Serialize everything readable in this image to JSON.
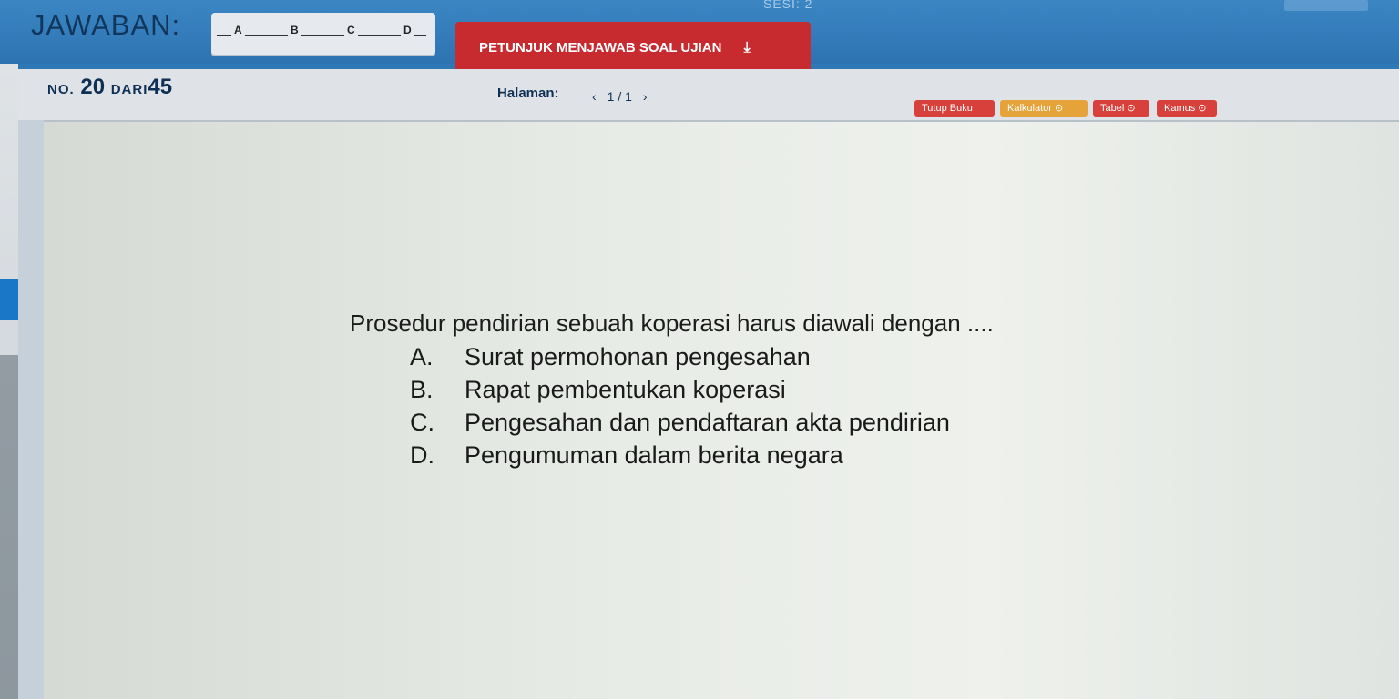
{
  "header": {
    "jawaban_label": "JAWABAN:",
    "answer_options": [
      "A",
      "B",
      "C",
      "D"
    ],
    "petunjuk_label": "PETUNJUK MENJAWAB SOAL UJIAN",
    "sesi": "SESI: 2"
  },
  "meta": {
    "no_prefix": "NO.",
    "number": "20",
    "dari": "DARI",
    "total": "45",
    "halaman_label": "Halaman:",
    "prev": "‹",
    "page": "1 / 1",
    "next": "›"
  },
  "tools": {
    "tutup_buku": "Tutup Buku",
    "kalkulator": "Kalkulator ⊙",
    "tabel": "Tabel ⊙",
    "kamus": "Kamus ⊙"
  },
  "question": {
    "text": "Prosedur pendirian sebuah koperasi harus diawali dengan ....",
    "options": [
      {
        "letter": "A.",
        "text": "Surat permohonan pengesahan"
      },
      {
        "letter": "B.",
        "text": "Rapat pembentukan koperasi"
      },
      {
        "letter": "C.",
        "text": "Pengesahan dan pendaftaran akta pendirian"
      },
      {
        "letter": "D.",
        "text": "Pengumuman dalam berita negara"
      }
    ]
  },
  "colors": {
    "header_blue": "#2f78b6",
    "petunjuk_red": "#c72a2f",
    "tool_red": "#d8403c",
    "tool_orange": "#e6a33a"
  }
}
